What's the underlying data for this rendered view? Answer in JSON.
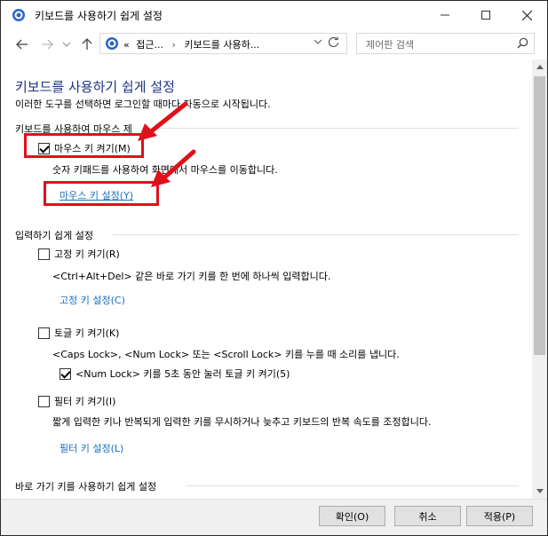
{
  "window": {
    "title": "키보드를 사용하기 쉽게 설정"
  },
  "address": {
    "breadcrumb_prefix": "«",
    "crumb1": "접근...",
    "crumb2": "키보드를 사용하...",
    "separator": "›"
  },
  "search": {
    "placeholder": "제어판 검색"
  },
  "page": {
    "heading": "키보드를 사용하기 쉽게 설정",
    "subtext": "이러한 도구를 선택하면 로그인할 때마다 자동으로 시작됩니다."
  },
  "mouse_section": {
    "title": "키보드를 사용하여 마우스 제",
    "mouse_keys_checkbox": "마우스 키 켜기(M)",
    "mouse_keys_checked": true,
    "mouse_keys_desc": "숫자 키패드를 사용하여 화면에서 마우스를 이동합니다.",
    "mouse_keys_link": "마우스 키 설정(Y)"
  },
  "typing_section": {
    "title": "입력하기 쉽게 설정",
    "sticky_keys_checkbox": "고정 키 켜기(R)",
    "sticky_keys_checked": false,
    "sticky_keys_desc": "<Ctrl+Alt+Del> 같은 바로 가기 키를 한 번에 하나씩 입력합니다.",
    "sticky_keys_link": "고정 키 설정(C)",
    "toggle_keys_checkbox": "토글 키 켜기(K)",
    "toggle_keys_checked": false,
    "toggle_keys_desc": "<Caps Lock>, <Num Lock> 또는 <Scroll Lock> 키를 누를 때 소리를 냅니다.",
    "numlock_checkbox": "<Num Lock> 키를 5초 동안 눌러 토글 키 켜기(5)",
    "numlock_checked": true,
    "filter_keys_checkbox": "필터 키 켜기(I)",
    "filter_keys_checked": false,
    "filter_keys_desc": "짧게 입력한 키나 반복되게 입력한 키를 무시하거나 늦추고 키보드의 반복 속도를 조정합니다.",
    "filter_keys_link": "필터 키 설정(L)"
  },
  "shortcut_section": {
    "title": "바로 가기 키를 사용하기 쉽게 설정"
  },
  "footer": {
    "ok": "확인(O)",
    "cancel": "취소",
    "apply": "적용(P)"
  },
  "colors": {
    "heading": "#1e3287",
    "link": "#1a6fc0",
    "annotation": "#e0101a"
  }
}
